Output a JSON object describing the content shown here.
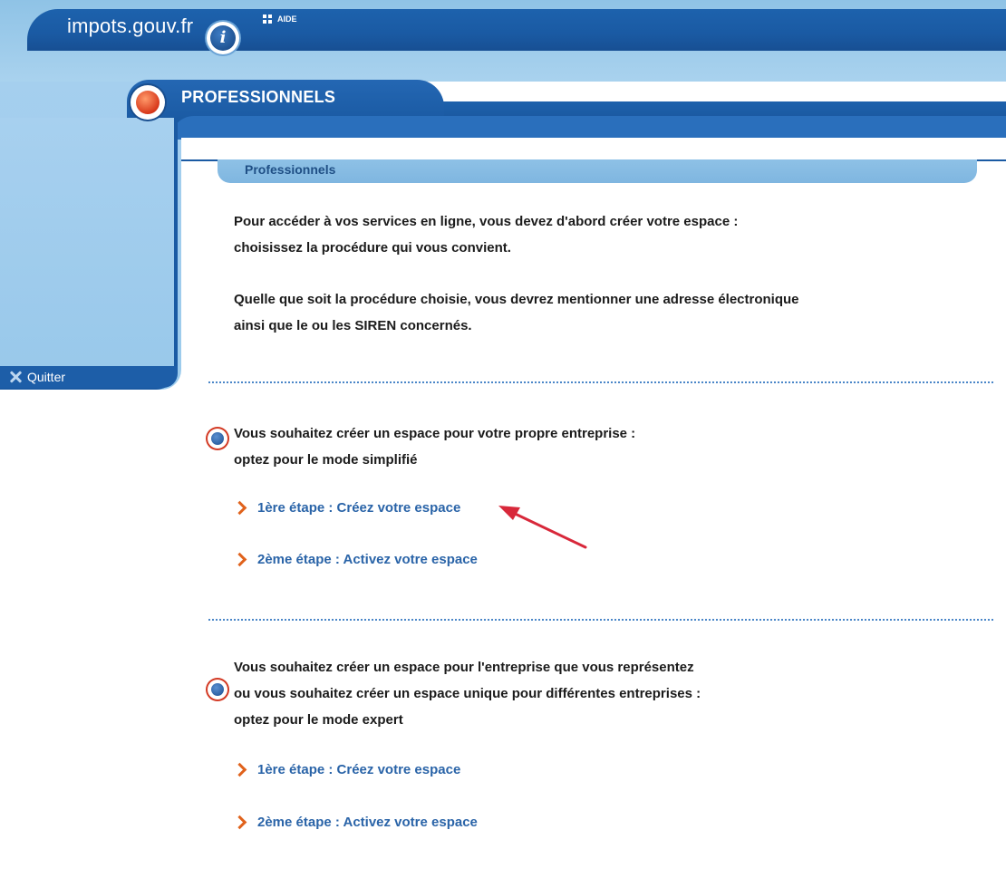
{
  "header": {
    "site_name": "impots.gouv.fr",
    "info_icon_glyph": "i",
    "help_label": "AIDE",
    "brand_color": "#1a5aa3",
    "accent_color": "#d8381a"
  },
  "section": {
    "title": "PROFESSIONNELS",
    "breadcrumb": "Professionnels"
  },
  "sidebar": {
    "quit_label": "Quitter"
  },
  "intro": {
    "paragraph_1_line_1": "Pour accéder à vos services en ligne, vous devez d'abord créer votre espace :",
    "paragraph_1_line_2": "choisissez la procédure qui vous convient.",
    "paragraph_2_line_1": "Quelle que soit la procédure choisie, vous devrez mentionner une adresse électronique",
    "paragraph_2_line_2": "ainsi que le ou les SIREN concernés."
  },
  "options": [
    {
      "line_1": "Vous souhaitez créer un espace pour votre propre entreprise :",
      "line_2": "optez pour le mode simplifié",
      "steps": [
        {
          "label": "1ère étape : Créez votre espace"
        },
        {
          "label": "2ème étape : Activez votre espace"
        }
      ]
    },
    {
      "line_1": "Vous souhaitez créer un espace pour l'entreprise que vous représentez",
      "line_2": "ou vous souhaitez créer un espace unique pour différentes entreprises :",
      "line_3": "optez pour le mode expert",
      "steps": [
        {
          "label": "1ère étape : Créez votre espace"
        },
        {
          "label": "2ème étape : Activez votre espace"
        }
      ]
    }
  ],
  "icons": {
    "info": "info-icon",
    "help": "help-dots-icon",
    "section": "section-bullet-icon",
    "quit": "close-x-icon",
    "option": "option-bullet-icon",
    "step": "chevron-right-icon",
    "annotation": "red-arrow-annotation"
  }
}
